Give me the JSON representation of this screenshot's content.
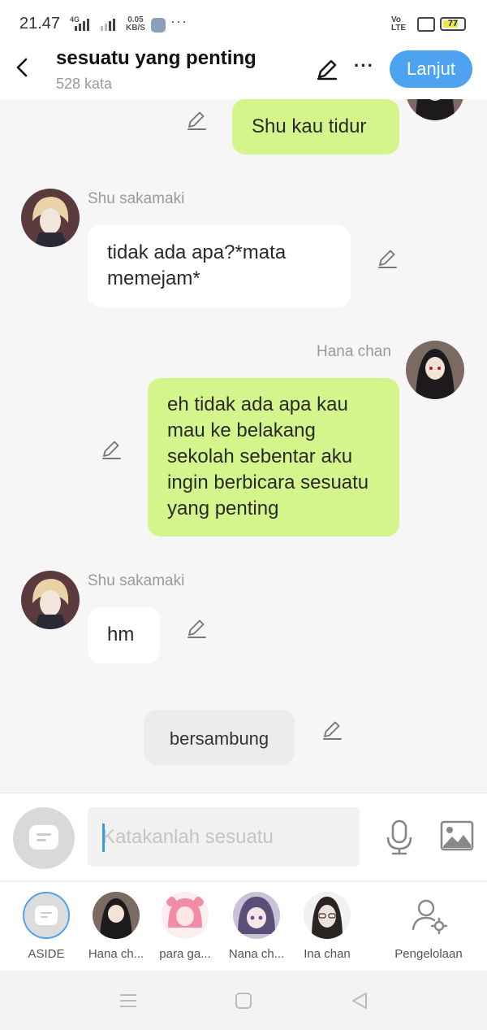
{
  "status_bar": {
    "time": "21.47",
    "network": "4G",
    "speed_value": "0.05",
    "speed_unit": "KB/S",
    "more": "···",
    "volte_top": "Vo",
    "volte_bottom": "LTE",
    "battery": "77"
  },
  "header": {
    "title": "sesuatu yang penting",
    "word_count": "528 kata",
    "more": "···",
    "next_label": "Lanjut"
  },
  "messages": [
    {
      "side": "right",
      "sender": "",
      "text": "Shu kau tidur"
    },
    {
      "side": "left",
      "sender": "Shu sakamaki",
      "text": "tidak ada apa?*mata memejam*"
    },
    {
      "side": "right",
      "sender": "Hana chan",
      "text": "eh tidak ada apa kau mau ke belakang sekolah sebentar aku ingin berbicara sesuatu yang penting"
    },
    {
      "side": "left",
      "sender": "Shu sakamaki",
      "text": "hm"
    },
    {
      "side": "center",
      "sender": "",
      "text": "bersambung"
    }
  ],
  "input": {
    "placeholder": "Katakanlah sesuatu"
  },
  "characters": [
    {
      "label": "ASIDE"
    },
    {
      "label": "Hana ch..."
    },
    {
      "label": "para ga..."
    },
    {
      "label": "Nana ch..."
    },
    {
      "label": "Ina chan"
    },
    {
      "label": "Pengelolaan"
    }
  ],
  "colors": {
    "accent": "#4ea3f0",
    "right_bubble": "#d4f58c",
    "left_bubble": "#ffffff",
    "background": "#f6f6f6"
  },
  "icons": [
    "back-icon",
    "pencil-icon",
    "more-icon",
    "microphone-icon",
    "image-icon",
    "aside-chat-icon",
    "manage-user-icon",
    "menu-icon",
    "home-icon",
    "back-triangle-icon"
  ]
}
